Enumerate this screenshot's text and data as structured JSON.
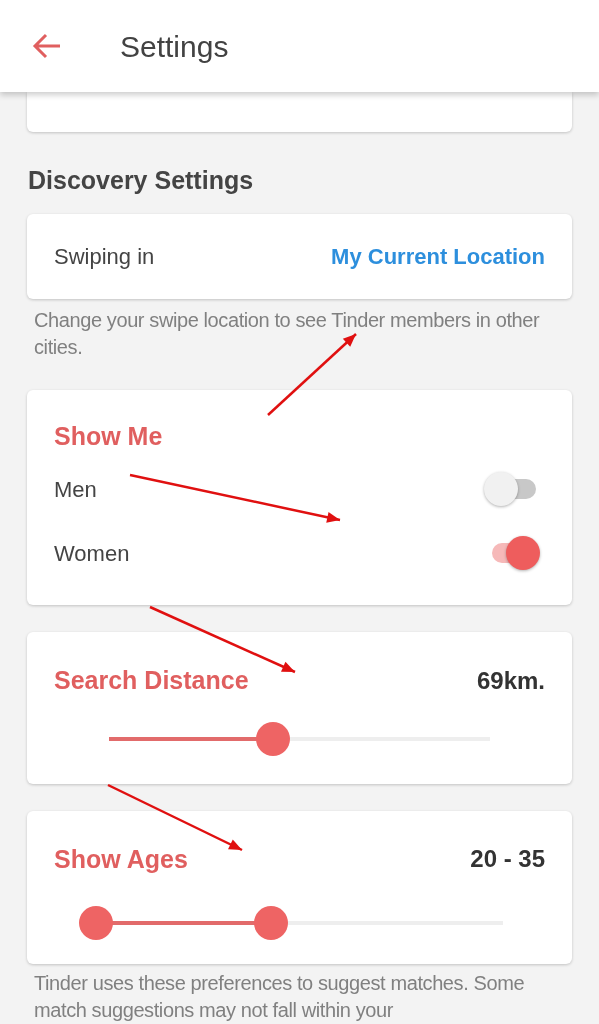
{
  "header": {
    "title": "Settings"
  },
  "section_title": "Discovery Settings",
  "location": {
    "label": "Swiping in",
    "value": "My Current Location",
    "note": "Change your swipe location to see Tinder members in other cities."
  },
  "show_me": {
    "title": "Show Me",
    "options": [
      {
        "label": "Men",
        "on": false
      },
      {
        "label": "Women",
        "on": true
      }
    ]
  },
  "distance": {
    "title": "Search Distance",
    "reading": "69km.",
    "level": 0.43
  },
  "ages": {
    "title": "Show Ages",
    "reading": "20 - 35",
    "thumbs": [
      {
        "level": 0
      },
      {
        "level": 0.43
      }
    ]
  },
  "footer_note": "Tinder uses these preferences to suggest matches. Some match suggestions may not fall within your"
}
